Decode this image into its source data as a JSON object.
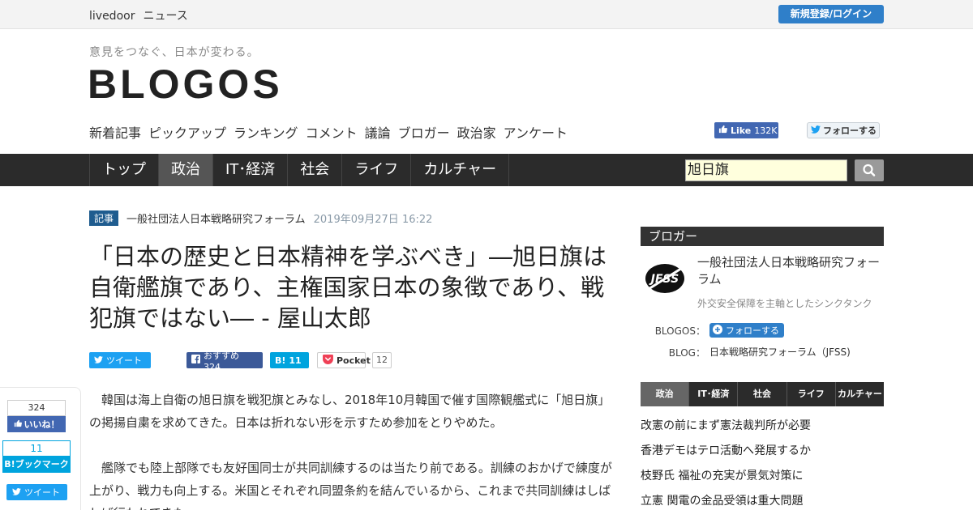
{
  "topbar": {
    "brand_main": "livedoor",
    "brand_sub": "ニュース",
    "register_label": "新規登録/ログイン"
  },
  "header": {
    "tagline": "意見をつなぐ、日本が変わる。",
    "logo": "BLOGOS",
    "subnav": [
      "新着記事",
      "ピックアップ",
      "ランキング",
      "コメント",
      "議論",
      "ブロガー",
      "政治家",
      "アンケート"
    ],
    "fb_like_label": "Like",
    "fb_like_count": "132K",
    "twitter_follow_label": "フォローする"
  },
  "mainnav": {
    "tabs": [
      {
        "label": "トップ",
        "active": false
      },
      {
        "label": "政治",
        "active": true
      },
      {
        "label": "IT･経済",
        "active": false
      },
      {
        "label": "社会",
        "active": false
      },
      {
        "label": "ライフ",
        "active": false
      },
      {
        "label": "カルチャー",
        "active": false
      }
    ],
    "search_value": "旭日旗"
  },
  "article": {
    "tag": "記事",
    "author": "一般社団法人日本戦略研究フォーラム",
    "date": "2019年09月27日 16:22",
    "title": "「日本の歴史と日本精神を学ぶべき」―旭日旗は自衛艦旗であり、主権国家日本の象徴であり、戦犯旗ではない― - 屋山太郎",
    "share": {
      "tweet": "ツイート",
      "fb_recommend": "おすすめ 324",
      "hatena_count": "11",
      "pocket": "Pocket",
      "pocket_count": "12"
    },
    "paragraphs": [
      "韓国は海上自衛の旭日旗を戦犯旗とみなし、2018年10月韓国で催す国際観艦式に「旭日旗」の掲揚自粛を求めてきた。日本は折れない形を示すため参加をとりやめた。",
      "艦隊でも陸上部隊でも友好国同士が共同訓練するのは当たり前である。訓練のおかげで練度が上がり、戦力も向上する。米国とそれぞれ同盟条約を結んでいるから、これまで共同訓練はしばしば行われてきた。"
    ]
  },
  "floating_share": {
    "fb_count": "324",
    "fb_label": "いいね！",
    "hatena_count": "11",
    "hatena_label": "B!ブックマーク",
    "tweet_label": "ツイート"
  },
  "sidebar": {
    "heading": "ブロガー",
    "blogger_name": "一般社団法人日本戦略研究フォーラム",
    "blogger_desc": "外交安全保障を主軸としたシンクタンク",
    "blogos_label": "BLOGOS：",
    "follow_label": "フォローする",
    "blog_label": "BLOG：",
    "blog_link": "日本戦略研究フォーラム（JFSS)",
    "category_tabs": [
      {
        "label": "政治",
        "active": true
      },
      {
        "label": "IT･経済",
        "active": false
      },
      {
        "label": "社会",
        "active": false
      },
      {
        "label": "ライフ",
        "active": false
      },
      {
        "label": "カルチャー",
        "active": false
      }
    ],
    "ranking": [
      "改憲の前にまず憲法裁判所が必要",
      "香港デモはテロ活動へ発展するか",
      "枝野氏 福祉の充実が景気対策に",
      "立憲 関電の金品受領は重大問題"
    ]
  }
}
